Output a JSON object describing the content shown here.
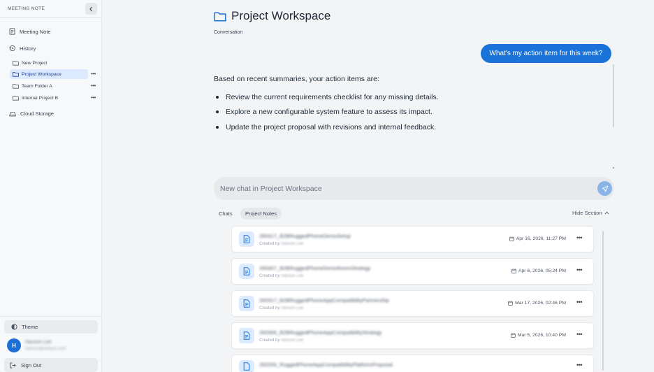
{
  "sidebar": {
    "app_title": "MEETING NOTE",
    "items": [
      {
        "label": "Meeting Note",
        "icon": "note-icon"
      },
      {
        "label": "History",
        "icon": "history-icon"
      }
    ],
    "projects": [
      {
        "label": "New Project",
        "active": false,
        "more": false
      },
      {
        "label": "Project Workspace",
        "active": true,
        "more": true
      },
      {
        "label": "Team Folder A",
        "active": false,
        "more": true
      },
      {
        "label": "Internal Project B",
        "active": false,
        "more": true
      }
    ],
    "cloud_storage": "Cloud Storage",
    "theme": "Theme",
    "user": {
      "initial": "H",
      "name": "Hanson Lee",
      "email": "hanson@hexaco.com"
    },
    "sign_out": "Sign Out"
  },
  "main": {
    "title": "Project Workspace",
    "subtitle": "Conversation",
    "user_message": "What's my action item for this week?",
    "assistant": {
      "intro": "Based on recent summaries, your action items are:",
      "bullets": [
        "Review the current requirements checklist for any missing details.",
        "Explore a new configurable system feature to assess its impact.",
        "Update the project proposal with revisions and internal feedback."
      ]
    },
    "input_placeholder": "New chat in Project Workspace",
    "tabs": [
      {
        "label": "Chats",
        "active": false
      },
      {
        "label": "Project Notes",
        "active": true
      }
    ],
    "hide_section": "Hide Section",
    "created_by_prefix": "Created by",
    "notes": [
      {
        "title": "260417_B2BRuggedPhoneDemoSetup",
        "author": "Hanson Lee",
        "date": "Apr 16, 2026, 11:27 PM"
      },
      {
        "title": "260407_B2BRuggedPhoneDemoRoomStrategy",
        "author": "Hanson Lee",
        "date": "Apr 6, 2026, 05:24 PM"
      },
      {
        "title": "260317_B2BRuggedPhoneAppCompatibilityPartnership",
        "author": "Hanson Lee",
        "date": "Mar 17, 2026, 02:46 PM"
      },
      {
        "title": "260306_B2BRuggedPhoneAppCompatibilityStrategy",
        "author": "Hanson Lee",
        "date": "Mar 5, 2026, 10:40 PM"
      },
      {
        "title": "260206_RuggedPhoneAppCompatibilityPlatformProposal",
        "author": "Hanson Lee",
        "date": ""
      }
    ]
  },
  "colors": {
    "accent": "#1a73d9",
    "active_bg": "#dbeafe",
    "send_button": "#8ab4e8"
  }
}
